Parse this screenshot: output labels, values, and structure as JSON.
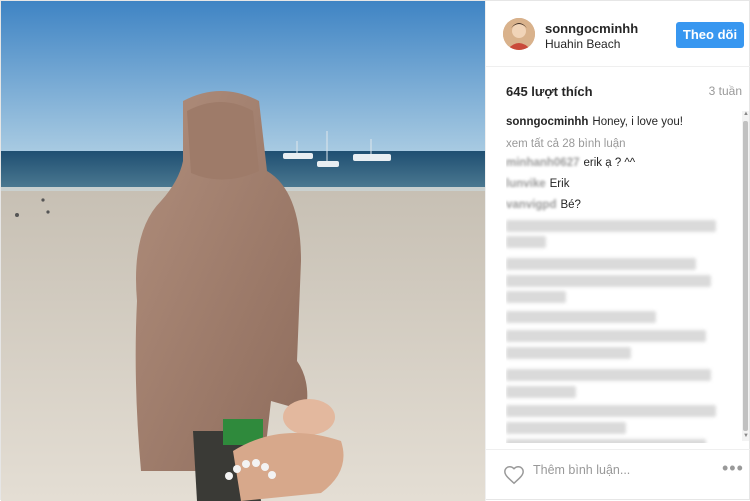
{
  "post": {
    "username": "sonngocminhh",
    "location": "Huahin Beach",
    "follow_label": "Theo dõi",
    "likes": "645 lượt thích",
    "time_ago": "3 tuần",
    "caption_user": "sonngocminhh",
    "caption_text": "Honey, i love you!",
    "view_all_comments": "xem tất cả 28 bình luận",
    "add_comment_placeholder": "Thêm bình luận...",
    "more_options": "•••"
  },
  "comments": [
    {
      "user": "minhanh0627",
      "text": "erik ạ ? ^^"
    },
    {
      "user": "lunvike",
      "text": "Erik"
    },
    {
      "user": "vanvigpd",
      "text": "Bé?"
    }
  ],
  "icons": {
    "heart": "heart-outline-icon",
    "more": "ellipsis-icon"
  },
  "colors": {
    "follow_button": "#3897f0",
    "secondary_text": "#999999"
  }
}
